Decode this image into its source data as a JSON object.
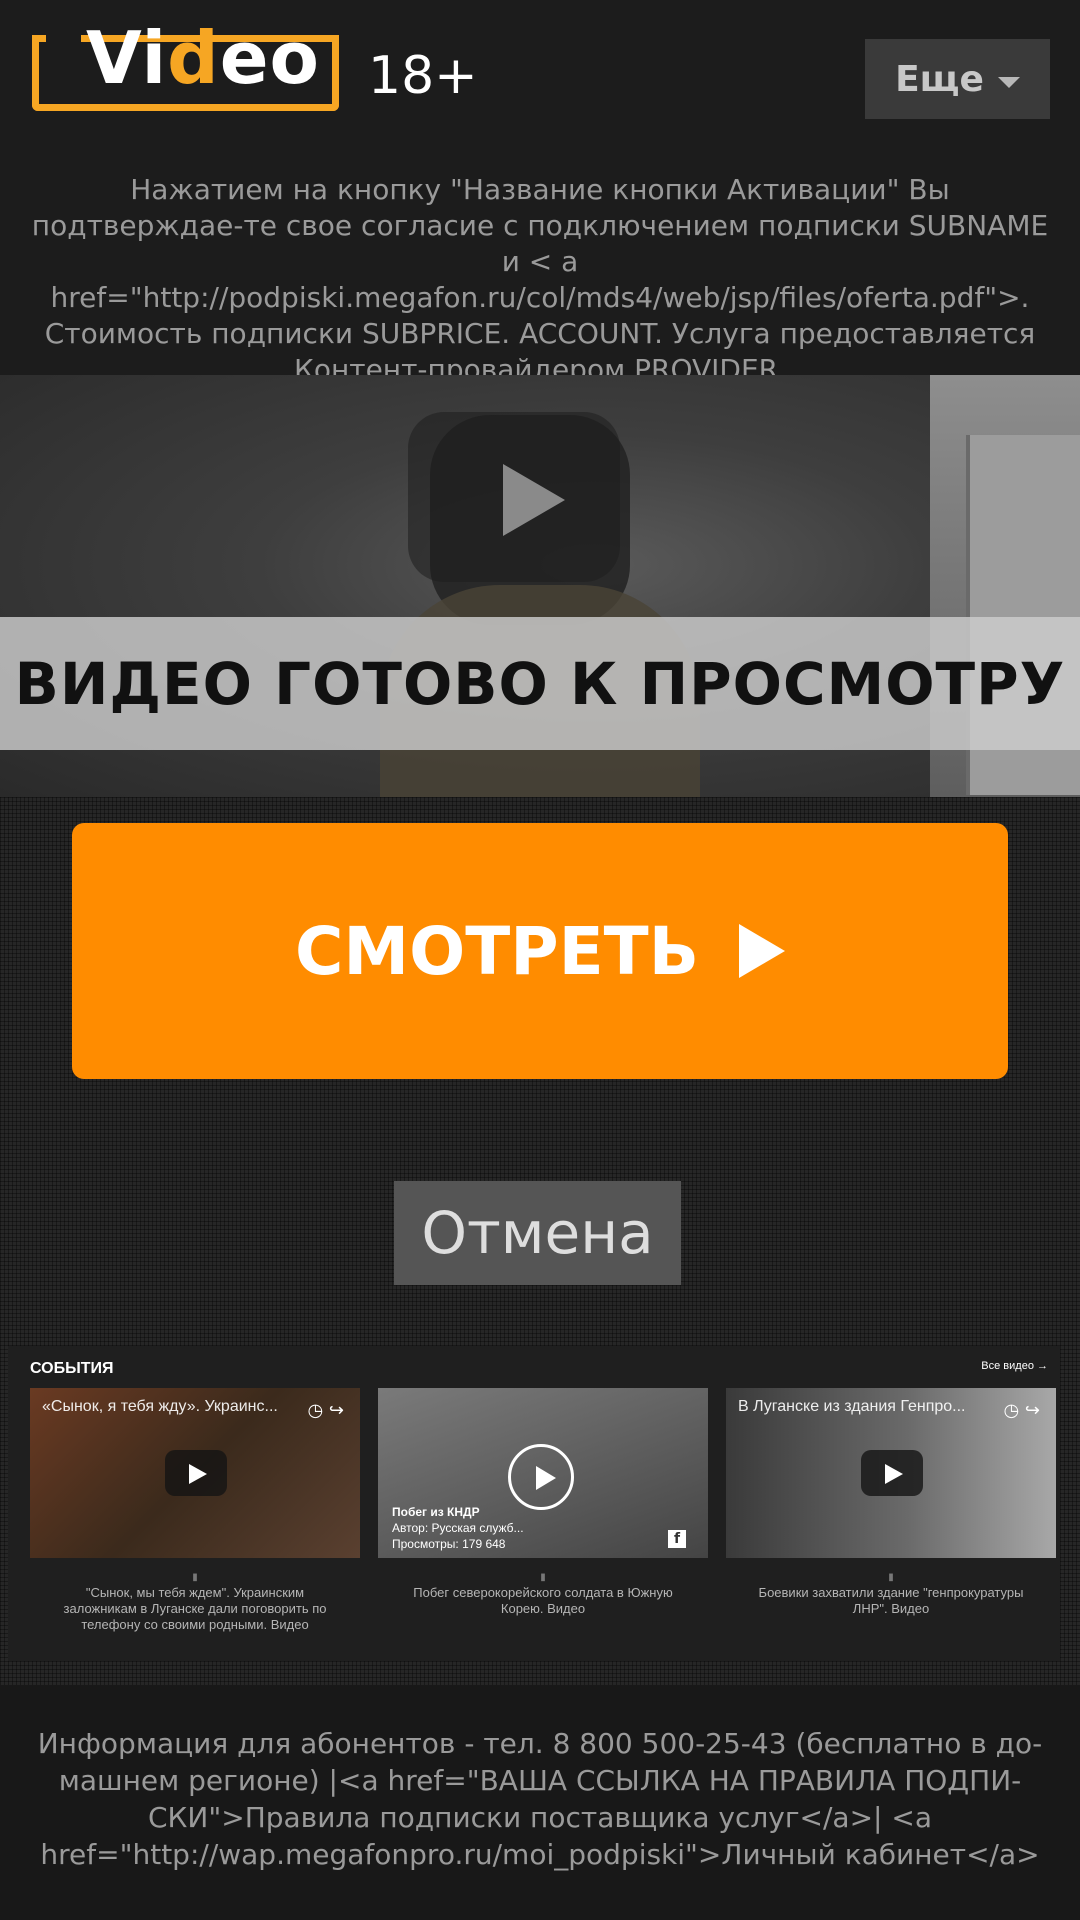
{
  "header": {
    "logo_prefix": "Vi",
    "logo_highlight": "d",
    "logo_suffix": "eo",
    "age_rating": "18+",
    "more_label": "Еще"
  },
  "disclaimer": "Нажатием на кнопку \"Название кнопки Активации\" Вы подтверждае-те свое согласие с подключением подписки SUBNAME и < a href=\"http://podpiski.megafon.ru/col/mds4/web/jsp/files/oferta.pdf\">. Стоимость подписки SUBPRICE. ACCOUNT. Услуга предоставляется Контент-провайдером PROVIDER.",
  "video": {
    "ready_text": "ВИДЕО ГОТОВО К ПРОСМОТРУ"
  },
  "actions": {
    "watch_label": "СМОТРЕТЬ",
    "cancel_label": "Отмена"
  },
  "events": {
    "title": "СОБЫТИЯ",
    "all_link": "Все видео →",
    "cards": [
      {
        "thumb_title": "«Сынок, я тебя жду». Украинс...",
        "caption": "\"Сынок, мы тебя ждем\". Украинским заложникам в Луганске дали поговорить по телефону со своими родными. Видео"
      },
      {
        "overlay_title": "Побег из КНДР",
        "overlay_author": "Автор: Русская служб...",
        "overlay_views": "Просмотры: 179 648",
        "caption": "Побег северокорейского солдата в Южную Корею. Видео"
      },
      {
        "thumb_title": "В Луганске из здания Генпро...",
        "caption": "Боевики захватили здание \"генпрокуратуры ЛНР\". Видео"
      }
    ]
  },
  "footer": {
    "text": "Информация для абонентов - тел. 8 800 500-25-43 (бесплатно в до-машнем регионе) |<a href=\"ВАША ССЫЛКА НА ПРАВИЛА ПОДПИ-СКИ\">Правила подписки поставщика услуг</a>| <a href=\"http://wap.megafonpro.ru/moi_podpiski\">Личный кабинет</a>"
  },
  "colors": {
    "accent": "#ff8c00",
    "logo": "#f6a623",
    "background": "#1c1c1c"
  }
}
